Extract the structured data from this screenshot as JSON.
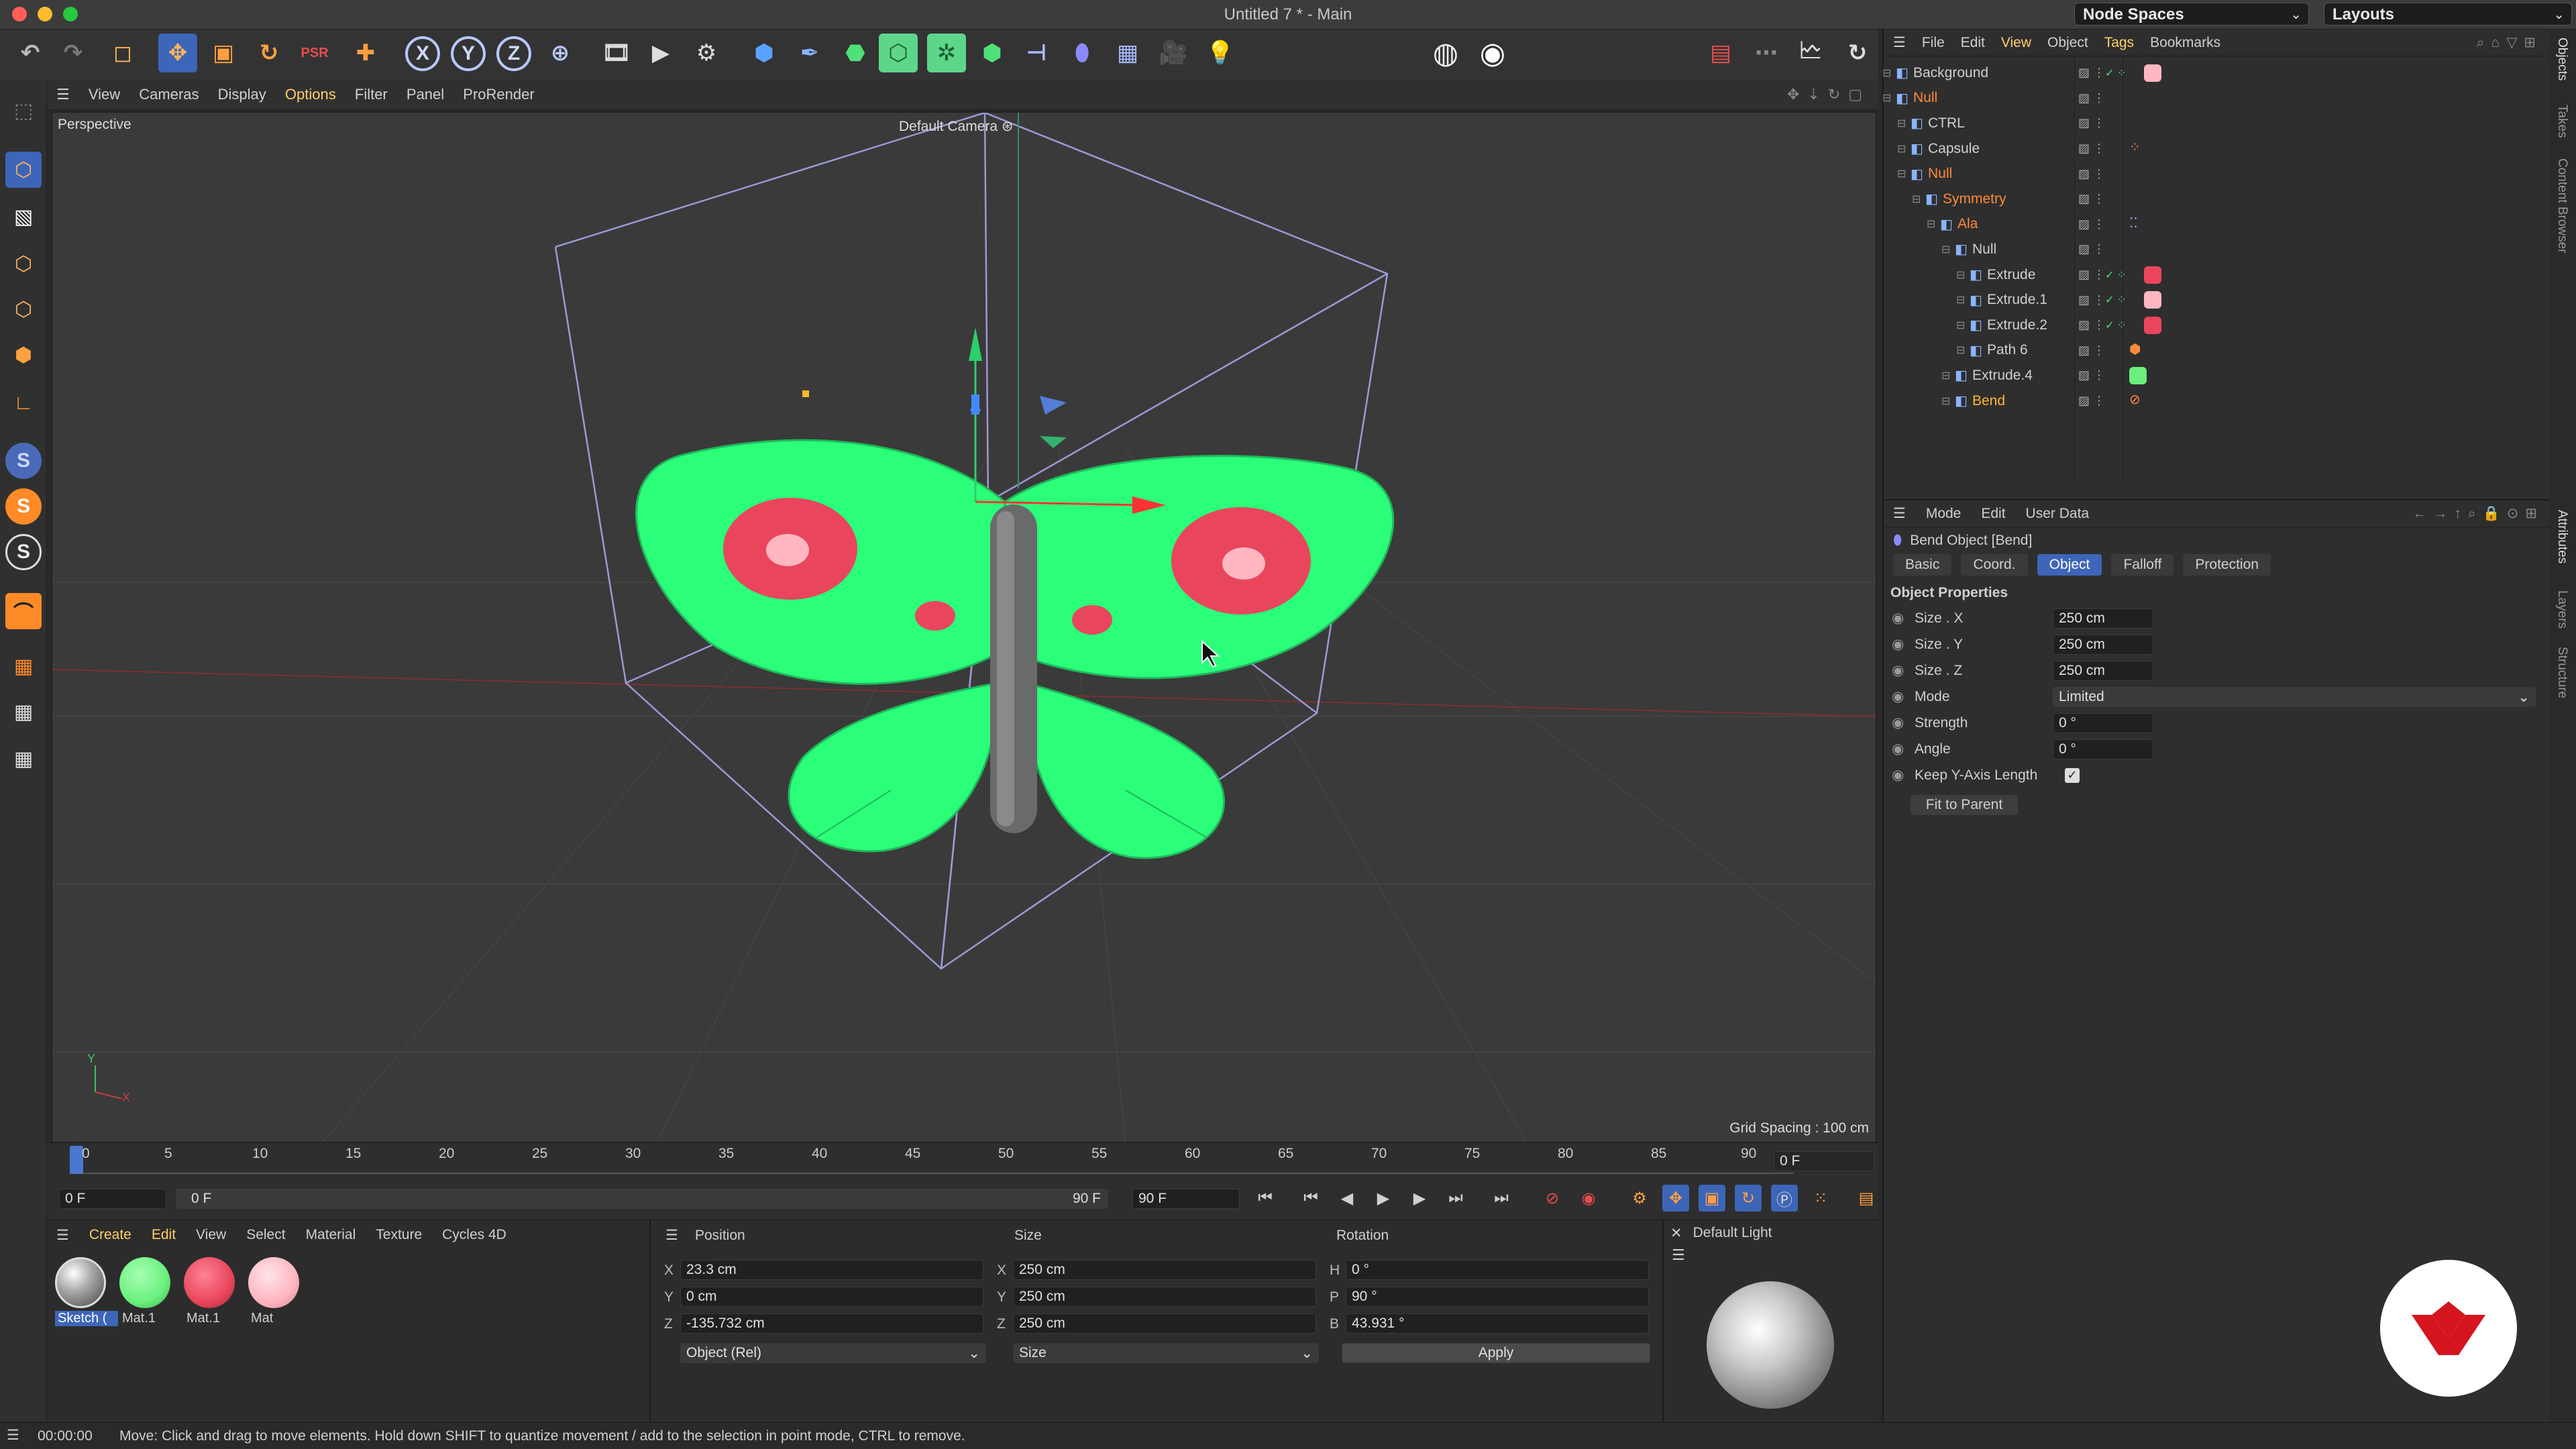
{
  "window": {
    "title": "Untitled 7 * - Main",
    "node_spaces_label": "Node Spaces",
    "layouts_label": "Layouts"
  },
  "colors": {
    "accent": "#3d65b8",
    "wing_green": "#2bff7a",
    "wing_red": "#e9465d",
    "wing_pink": "#ffb6c1",
    "selected_text": "#ffb62e",
    "null_orange": "#ff8a3c"
  },
  "toolbar": {
    "icons": [
      "undo-icon",
      "redo-icon",
      "live-selection-icon",
      "move-icon",
      "scale-icon",
      "rotate-icon",
      "psr-icon",
      "add-icon",
      "x-axis-icon",
      "y-axis-icon",
      "z-axis-icon",
      "world-coordinate-icon",
      "render-region-icon",
      "render-view-icon",
      "render-settings-icon",
      "cube-icon",
      "pen-icon",
      "subdivision-icon",
      "extrude-icon",
      "array-icon",
      "cloner-icon",
      "deformer-icon",
      "bend-icon",
      "floor-icon",
      "camera-icon",
      "light-icon",
      "prorender-icon",
      "record-icon",
      "layout-icon",
      "picture-viewer-icon",
      "timeline-icon",
      "reset-icon"
    ],
    "axis_x": "X",
    "axis_y": "Y",
    "axis_z": "Z"
  },
  "viewport_menu": [
    "View",
    "Cameras",
    "Display",
    "Options",
    "Filter",
    "Panel",
    "ProRender"
  ],
  "viewport": {
    "name": "Perspective",
    "camera": "Default Camera",
    "grid_spacing": "Grid Spacing : 100 cm",
    "axis_y_label": "Y",
    "axis_x_label": "X"
  },
  "timeline": {
    "ticks": [
      "0",
      "5",
      "10",
      "15",
      "20",
      "25",
      "30",
      "35",
      "40",
      "45",
      "50",
      "55",
      "60",
      "65",
      "70",
      "75",
      "80",
      "85",
      "90"
    ],
    "current_frame": "0 F",
    "start_frame": "0 F",
    "range_start": "0 F",
    "range_end": "90 F",
    "end_frame": "90 F"
  },
  "material_manager": {
    "menu": [
      "Create",
      "Edit",
      "View",
      "Select",
      "Material",
      "Texture",
      "Cycles 4D"
    ],
    "materials": [
      {
        "name": "Sketch (",
        "color": "#c8c8c8",
        "selected": true
      },
      {
        "name": "Mat.1",
        "color": "#6bf07e",
        "selected": false
      },
      {
        "name": "Mat.1",
        "color": "#e9465d",
        "selected": false
      },
      {
        "name": "Mat",
        "color": "#ffb6c1",
        "selected": false
      }
    ]
  },
  "coordinates": {
    "headers": {
      "position": "Position",
      "size": "Size",
      "rotation": "Rotation"
    },
    "rows": [
      {
        "axis": "X",
        "pos": "23.3 cm",
        "size_axis": "X",
        "size": "250 cm",
        "rot_axis": "H",
        "rot": "0 °"
      },
      {
        "axis": "Y",
        "pos": "0 cm",
        "size_axis": "Y",
        "size": "250 cm",
        "rot_axis": "P",
        "rot": "90 °"
      },
      {
        "axis": "Z",
        "pos": "-135.732 cm",
        "size_axis": "Z",
        "size": "250 cm",
        "rot_axis": "B",
        "rot": "43.931 °"
      }
    ],
    "mode_select": "Object (Rel)",
    "size_select": "Size",
    "apply_label": "Apply"
  },
  "light_preview": {
    "title": "Default Light"
  },
  "status": {
    "time": "00:00:00",
    "message": "Move: Click and drag to move elements. Hold down SHIFT to quantize movement / add to the selection in point mode, CTRL to remove."
  },
  "object_manager": {
    "menu": [
      "File",
      "Edit",
      "View",
      "Object",
      "Tags",
      "Bookmarks"
    ],
    "objects": [
      {
        "name": "Background",
        "indent": 0,
        "color": "#d0d0d0",
        "tag": "pink"
      },
      {
        "name": "Null",
        "indent": 0,
        "color": "#ff8a3c",
        "tag": ""
      },
      {
        "name": "CTRL",
        "indent": 1,
        "color": "#d0d0d0",
        "tag": ""
      },
      {
        "name": "Capsule",
        "indent": 1,
        "color": "#d0d0d0",
        "tag": "dots"
      },
      {
        "name": "Null",
        "indent": 1,
        "color": "#ff8a3c",
        "tag": ""
      },
      {
        "name": "Symmetry",
        "indent": 2,
        "color": "#ff8a3c",
        "tag": ""
      },
      {
        "name": "Ala",
        "indent": 3,
        "color": "#ff8a3c",
        "tag": "blue"
      },
      {
        "name": "Null",
        "indent": 4,
        "color": "#d0d0d0",
        "tag": ""
      },
      {
        "name": "Extrude",
        "indent": 5,
        "color": "#d0d0d0",
        "tag": "red"
      },
      {
        "name": "Extrude.1",
        "indent": 5,
        "color": "#d0d0d0",
        "tag": "pink"
      },
      {
        "name": "Extrude.2",
        "indent": 5,
        "color": "#d0d0d0",
        "tag": "red"
      },
      {
        "name": "Path 6",
        "indent": 5,
        "color": "#d0d0d0",
        "tag": "orange"
      },
      {
        "name": "Extrude.4",
        "indent": 4,
        "color": "#d0d0d0",
        "tag": "green"
      },
      {
        "name": "Bend",
        "indent": 4,
        "color": "#ffb62e",
        "tag": "bend"
      }
    ]
  },
  "attributes": {
    "menu": [
      "Mode",
      "Edit",
      "User Data"
    ],
    "object_title": "Bend Object [Bend]",
    "tabs": [
      "Basic",
      "Coord.",
      "Object",
      "Falloff",
      "Protection"
    ],
    "active_tab": "Object",
    "section": "Object Properties",
    "props": [
      {
        "label": "Size . X",
        "value": "250 cm"
      },
      {
        "label": "Size . Y",
        "value": "250 cm"
      },
      {
        "label": "Size . Z",
        "value": "250 cm"
      },
      {
        "label": "Mode",
        "value": "Limited"
      },
      {
        "label": "Strength",
        "value": "0 °"
      },
      {
        "label": "Angle",
        "value": "0 °"
      },
      {
        "label": "Keep Y-Axis Length",
        "value": "checked"
      }
    ],
    "fit_button": "Fit to Parent"
  },
  "side_tabs": [
    "Objects",
    "Takes",
    "Content Browser",
    "Attributes",
    "Layers",
    "Structure"
  ]
}
